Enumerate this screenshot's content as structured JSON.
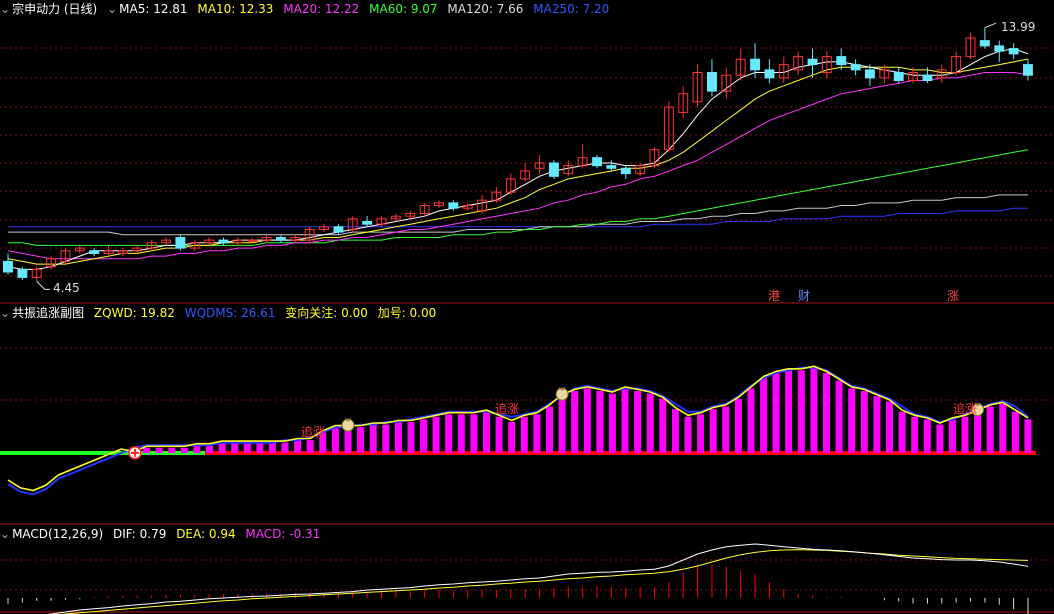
{
  "colors": {
    "bg": "#000000",
    "grid": "#8a1010",
    "up": "#ff3333",
    "down": "#66e8ff",
    "ma5": "#ffffff",
    "ma10": "#ffff33",
    "ma20": "#ff33ff",
    "ma60": "#33ff33",
    "ma120": "#c8c8c8",
    "ma250": "#3333ff",
    "bar": "#ff00ff",
    "red": "#ff0000",
    "green": "#22ff22"
  },
  "header": {
    "title_menu_icon": "dropdown-arrow-icon",
    "name": "宗申动力 (日线)",
    "ma5": "MA5: 12.81",
    "ma10": "MA10: 12.33",
    "ma20": "MA20: 12.22",
    "ma60": "MA60: 9.07",
    "ma120": "MA120: 7.66",
    "ma250": "MA250: 7.20",
    "high_label": "13.99",
    "low_label": "4.45",
    "tags": [
      "港",
      "财",
      "涨"
    ]
  },
  "panel2": {
    "name": "共振追涨副图",
    "zqwd": "ZQWD: 19.82",
    "wqdms": "WQDMS: 26.61",
    "bianxiang": "变向关注: 0.00",
    "jiahao": "加号: 0.00",
    "signal_label": "追涨"
  },
  "panel3": {
    "name": "MACD(12,26,9)",
    "dif": "DIF: 0.79",
    "dea": "DEA: 0.94",
    "macd": "MACD: -0.31"
  },
  "chart_data": [
    {
      "type": "candlestick",
      "title": "宗申动力 (日线)",
      "price_range": [
        4.45,
        13.99
      ],
      "candles": [
        {
          "o": 5.2,
          "c": 4.8,
          "h": 5.5,
          "l": 4.7
        },
        {
          "o": 4.9,
          "c": 4.6,
          "h": 5.0,
          "l": 4.5
        },
        {
          "o": 4.6,
          "c": 4.9,
          "h": 5.0,
          "l": 4.45
        },
        {
          "o": 5.0,
          "c": 5.3,
          "h": 5.4,
          "l": 4.9
        },
        {
          "o": 5.2,
          "c": 5.6,
          "h": 5.7,
          "l": 5.1
        },
        {
          "o": 5.6,
          "c": 5.7,
          "h": 5.8,
          "l": 5.5
        },
        {
          "o": 5.6,
          "c": 5.5,
          "h": 5.7,
          "l": 5.4
        },
        {
          "o": 5.5,
          "c": 5.6,
          "h": 5.8,
          "l": 5.4
        },
        {
          "o": 5.5,
          "c": 5.6,
          "h": 5.7,
          "l": 5.4
        },
        {
          "o": 5.6,
          "c": 5.7,
          "h": 5.8,
          "l": 5.5
        },
        {
          "o": 5.7,
          "c": 5.9,
          "h": 6.0,
          "l": 5.6
        },
        {
          "o": 5.9,
          "c": 6.0,
          "h": 6.1,
          "l": 5.8
        },
        {
          "o": 6.1,
          "c": 5.7,
          "h": 6.2,
          "l": 5.6
        },
        {
          "o": 5.7,
          "c": 5.9,
          "h": 6.0,
          "l": 5.6
        },
        {
          "o": 5.9,
          "c": 6.0,
          "h": 6.1,
          "l": 5.8
        },
        {
          "o": 6.0,
          "c": 5.9,
          "h": 6.1,
          "l": 5.8
        },
        {
          "o": 5.9,
          "c": 6.0,
          "h": 6.1,
          "l": 5.8
        },
        {
          "o": 6.0,
          "c": 6.0,
          "h": 6.1,
          "l": 5.9
        },
        {
          "o": 6.0,
          "c": 6.1,
          "h": 6.2,
          "l": 5.9
        },
        {
          "o": 6.1,
          "c": 6.0,
          "h": 6.2,
          "l": 5.9
        },
        {
          "o": 6.0,
          "c": 6.1,
          "h": 6.2,
          "l": 5.9
        },
        {
          "o": 6.0,
          "c": 6.4,
          "h": 6.5,
          "l": 5.9
        },
        {
          "o": 6.4,
          "c": 6.5,
          "h": 6.6,
          "l": 6.3
        },
        {
          "o": 6.5,
          "c": 6.3,
          "h": 6.6,
          "l": 6.2
        },
        {
          "o": 6.4,
          "c": 6.8,
          "h": 6.9,
          "l": 6.3
        },
        {
          "o": 6.7,
          "c": 6.6,
          "h": 6.9,
          "l": 6.5
        },
        {
          "o": 6.6,
          "c": 6.8,
          "h": 6.9,
          "l": 6.5
        },
        {
          "o": 6.8,
          "c": 6.9,
          "h": 7.0,
          "l": 6.7
        },
        {
          "o": 6.9,
          "c": 7.0,
          "h": 7.1,
          "l": 6.8
        },
        {
          "o": 7.0,
          "c": 7.3,
          "h": 7.4,
          "l": 6.9
        },
        {
          "o": 7.3,
          "c": 7.4,
          "h": 7.5,
          "l": 7.2
        },
        {
          "o": 7.4,
          "c": 7.2,
          "h": 7.5,
          "l": 7.1
        },
        {
          "o": 7.2,
          "c": 7.3,
          "h": 7.4,
          "l": 7.1
        },
        {
          "o": 7.1,
          "c": 7.5,
          "h": 7.7,
          "l": 7.0
        },
        {
          "o": 7.5,
          "c": 7.8,
          "h": 8.0,
          "l": 7.4
        },
        {
          "o": 7.8,
          "c": 8.3,
          "h": 8.5,
          "l": 7.7
        },
        {
          "o": 8.3,
          "c": 8.6,
          "h": 8.9,
          "l": 8.2
        },
        {
          "o": 8.7,
          "c": 8.9,
          "h": 9.2,
          "l": 8.5
        },
        {
          "o": 8.9,
          "c": 8.4,
          "h": 9.0,
          "l": 8.3
        },
        {
          "o": 8.5,
          "c": 8.8,
          "h": 9.0,
          "l": 8.4
        },
        {
          "o": 8.8,
          "c": 9.1,
          "h": 9.6,
          "l": 8.7
        },
        {
          "o": 9.1,
          "c": 8.8,
          "h": 9.2,
          "l": 8.7
        },
        {
          "o": 8.8,
          "c": 8.7,
          "h": 9.0,
          "l": 8.6
        },
        {
          "o": 8.7,
          "c": 8.5,
          "h": 8.8,
          "l": 8.3
        },
        {
          "o": 8.5,
          "c": 8.8,
          "h": 8.9,
          "l": 8.4
        },
        {
          "o": 8.8,
          "c": 9.4,
          "h": 9.5,
          "l": 8.7
        },
        {
          "o": 9.4,
          "c": 11.0,
          "h": 11.2,
          "l": 9.3
        },
        {
          "o": 10.8,
          "c": 11.5,
          "h": 11.8,
          "l": 10.6
        },
        {
          "o": 11.2,
          "c": 12.3,
          "h": 12.6,
          "l": 11.0
        },
        {
          "o": 12.3,
          "c": 11.6,
          "h": 12.8,
          "l": 11.4
        },
        {
          "o": 11.6,
          "c": 12.2,
          "h": 12.5,
          "l": 11.3
        },
        {
          "o": 12.2,
          "c": 12.8,
          "h": 13.2,
          "l": 12.0
        },
        {
          "o": 12.8,
          "c": 12.4,
          "h": 13.4,
          "l": 12.1
        },
        {
          "o": 12.4,
          "c": 12.1,
          "h": 12.8,
          "l": 11.9
        },
        {
          "o": 12.1,
          "c": 12.6,
          "h": 12.9,
          "l": 11.9
        },
        {
          "o": 12.4,
          "c": 12.9,
          "h": 13.1,
          "l": 12.2
        },
        {
          "o": 12.8,
          "c": 12.6,
          "h": 13.2,
          "l": 12.1
        },
        {
          "o": 12.3,
          "c": 12.9,
          "h": 13.1,
          "l": 12.1
        },
        {
          "o": 12.9,
          "c": 12.6,
          "h": 13.2,
          "l": 12.4
        },
        {
          "o": 12.6,
          "c": 12.4,
          "h": 12.8,
          "l": 12.2
        },
        {
          "o": 12.4,
          "c": 12.1,
          "h": 12.6,
          "l": 11.8
        },
        {
          "o": 12.1,
          "c": 12.4,
          "h": 12.6,
          "l": 11.9
        },
        {
          "o": 12.3,
          "c": 12.0,
          "h": 12.5,
          "l": 11.9
        },
        {
          "o": 12.0,
          "c": 12.3,
          "h": 12.5,
          "l": 11.9
        },
        {
          "o": 12.2,
          "c": 12.0,
          "h": 12.5,
          "l": 11.9
        },
        {
          "o": 12.1,
          "c": 12.4,
          "h": 12.6,
          "l": 11.9
        },
        {
          "o": 12.3,
          "c": 12.9,
          "h": 13.1,
          "l": 12.2
        },
        {
          "o": 12.9,
          "c": 13.6,
          "h": 13.8,
          "l": 12.8
        },
        {
          "o": 13.5,
          "c": 13.3,
          "h": 13.99,
          "l": 13.2
        },
        {
          "o": 13.3,
          "c": 13.1,
          "h": 13.5,
          "l": 12.7
        },
        {
          "o": 13.2,
          "c": 13.0,
          "h": 13.4,
          "l": 12.8
        },
        {
          "o": 12.6,
          "c": 12.2,
          "h": 12.8,
          "l": 12.0
        }
      ],
      "ma5": [
        5.0,
        4.9,
        4.9,
        5.0,
        5.2,
        5.4,
        5.6,
        5.6,
        5.6,
        5.6,
        5.7,
        5.8,
        5.8,
        5.9,
        5.9,
        5.9,
        6.0,
        6.0,
        6.0,
        6.0,
        6.0,
        6.1,
        6.2,
        6.3,
        6.4,
        6.5,
        6.6,
        6.7,
        6.8,
        6.9,
        7.1,
        7.2,
        7.3,
        7.4,
        7.5,
        7.8,
        8.1,
        8.4,
        8.6,
        8.7,
        8.8,
        8.9,
        8.9,
        8.8,
        8.8,
        8.9,
        9.4,
        10.0,
        10.7,
        11.3,
        11.7,
        12.1,
        12.3,
        12.3,
        12.3,
        12.5,
        12.6,
        12.7,
        12.7,
        12.6,
        12.5,
        12.4,
        12.3,
        12.2,
        12.2,
        12.2,
        12.3,
        12.6,
        12.9,
        13.1,
        13.2,
        13.0
      ],
      "ma10": [
        5.3,
        5.2,
        5.1,
        5.1,
        5.1,
        5.2,
        5.3,
        5.4,
        5.5,
        5.5,
        5.6,
        5.7,
        5.7,
        5.8,
        5.8,
        5.9,
        5.9,
        5.9,
        6.0,
        6.0,
        6.0,
        6.0,
        6.1,
        6.1,
        6.2,
        6.3,
        6.4,
        6.5,
        6.6,
        6.7,
        6.8,
        6.9,
        7.0,
        7.1,
        7.2,
        7.4,
        7.6,
        7.9,
        8.1,
        8.3,
        8.4,
        8.5,
        8.6,
        8.7,
        8.7,
        8.8,
        9.0,
        9.3,
        9.7,
        10.1,
        10.5,
        10.9,
        11.3,
        11.6,
        11.8,
        12.0,
        12.2,
        12.4,
        12.5,
        12.5,
        12.5,
        12.5,
        12.5,
        12.4,
        12.4,
        12.3,
        12.3,
        12.4,
        12.5,
        12.6,
        12.7,
        12.81
      ],
      "ma20": [
        5.6,
        5.5,
        5.4,
        5.3,
        5.3,
        5.3,
        5.3,
        5.3,
        5.3,
        5.3,
        5.4,
        5.4,
        5.5,
        5.5,
        5.6,
        5.6,
        5.7,
        5.7,
        5.8,
        5.8,
        5.9,
        5.9,
        6.0,
        6.0,
        6.1,
        6.1,
        6.2,
        6.3,
        6.4,
        6.4,
        6.5,
        6.6,
        6.7,
        6.8,
        6.9,
        7.0,
        7.1,
        7.2,
        7.4,
        7.5,
        7.7,
        7.8,
        8.0,
        8.1,
        8.3,
        8.4,
        8.6,
        8.8,
        9.0,
        9.3,
        9.6,
        9.9,
        10.2,
        10.5,
        10.7,
        10.9,
        11.1,
        11.3,
        11.5,
        11.6,
        11.7,
        11.8,
        11.9,
        12.0,
        12.0,
        12.1,
        12.1,
        12.2,
        12.3,
        12.3,
        12.3,
        12.22
      ],
      "ma60": [
        5.9,
        5.9,
        5.8,
        5.8,
        5.8,
        5.8,
        5.8,
        5.8,
        5.8,
        5.8,
        5.8,
        5.8,
        5.8,
        5.8,
        5.8,
        5.8,
        5.8,
        5.8,
        5.9,
        5.9,
        5.9,
        5.9,
        5.9,
        6.0,
        6.0,
        6.0,
        6.0,
        6.1,
        6.1,
        6.1,
        6.1,
        6.2,
        6.2,
        6.2,
        6.3,
        6.3,
        6.4,
        6.4,
        6.5,
        6.5,
        6.6,
        6.6,
        6.7,
        6.7,
        6.8,
        6.8,
        6.9,
        7.0,
        7.1,
        7.2,
        7.3,
        7.4,
        7.5,
        7.6,
        7.7,
        7.8,
        7.9,
        8.0,
        8.1,
        8.2,
        8.3,
        8.4,
        8.5,
        8.6,
        8.7,
        8.8,
        8.9,
        9.0,
        9.1,
        9.2,
        9.3,
        9.4
      ],
      "ma120": [
        6.3,
        6.3,
        6.3,
        6.3,
        6.3,
        6.3,
        6.3,
        6.3,
        6.2,
        6.2,
        6.2,
        6.2,
        6.2,
        6.2,
        6.2,
        6.2,
        6.2,
        6.2,
        6.2,
        6.2,
        6.2,
        6.2,
        6.2,
        6.2,
        6.3,
        6.3,
        6.3,
        6.3,
        6.3,
        6.3,
        6.3,
        6.3,
        6.4,
        6.4,
        6.4,
        6.4,
        6.4,
        6.5,
        6.5,
        6.5,
        6.5,
        6.6,
        6.6,
        6.6,
        6.7,
        6.7,
        6.7,
        6.8,
        6.8,
        6.9,
        6.9,
        7.0,
        7.0,
        7.1,
        7.1,
        7.2,
        7.2,
        7.2,
        7.3,
        7.3,
        7.4,
        7.4,
        7.4,
        7.5,
        7.5,
        7.5,
        7.6,
        7.6,
        7.6,
        7.7,
        7.7,
        7.7
      ],
      "ma250": [
        6.5,
        6.5,
        6.5,
        6.5,
        6.5,
        6.5,
        6.5,
        6.5,
        6.5,
        6.5,
        6.5,
        6.5,
        6.5,
        6.5,
        6.5,
        6.5,
        6.5,
        6.5,
        6.5,
        6.5,
        6.5,
        6.5,
        6.5,
        6.5,
        6.5,
        6.5,
        6.5,
        6.5,
        6.5,
        6.5,
        6.5,
        6.5,
        6.5,
        6.5,
        6.5,
        6.5,
        6.5,
        6.5,
        6.5,
        6.5,
        6.5,
        6.5,
        6.5,
        6.5,
        6.5,
        6.6,
        6.6,
        6.6,
        6.6,
        6.6,
        6.7,
        6.7,
        6.7,
        6.7,
        6.8,
        6.8,
        6.8,
        6.8,
        6.9,
        6.9,
        6.9,
        6.9,
        7.0,
        7.0,
        7.0,
        7.0,
        7.1,
        7.1,
        7.1,
        7.1,
        7.2,
        7.2
      ]
    },
    {
      "type": "bar",
      "title": "共振追涨副图",
      "y_range": [
        -20,
        40
      ],
      "zqwd_bars": [
        0,
        0,
        0,
        0,
        0,
        0,
        0,
        0,
        0,
        0,
        0,
        2,
        2,
        2,
        2,
        3,
        3,
        4,
        4,
        4,
        4,
        4,
        4,
        5,
        5,
        8,
        10,
        10,
        10,
        11,
        11,
        12,
        12,
        13,
        14,
        15,
        15,
        15,
        16,
        14,
        12,
        14,
        15,
        18,
        22,
        24,
        25,
        24,
        23,
        25,
        24,
        23,
        21,
        17,
        14,
        15,
        17,
        18,
        21,
        25,
        29,
        31,
        32,
        32,
        33,
        31,
        28,
        25,
        24,
        22,
        20,
        16,
        14,
        13,
        11,
        13,
        14,
        16,
        18,
        19,
        16,
        13
      ],
      "wqdms": [
        -12,
        -15,
        -16,
        -14,
        -10,
        -8,
        -6,
        -4,
        -2,
        0,
        2,
        3,
        3,
        3,
        3,
        3,
        3,
        4,
        4,
        4,
        4,
        4,
        5,
        5,
        6,
        8,
        10,
        10,
        11,
        11,
        12,
        12,
        13,
        14,
        15,
        16,
        16,
        16,
        16,
        15,
        14,
        15,
        16,
        19,
        22,
        25,
        26,
        25,
        24,
        25,
        25,
        24,
        22,
        19,
        16,
        16,
        18,
        19,
        22,
        26,
        29,
        31,
        32,
        33,
        33,
        32,
        29,
        26,
        25,
        23,
        21,
        18,
        15,
        14,
        12,
        13,
        15,
        17,
        19,
        20,
        18,
        14
      ],
      "signals": [
        27,
        44,
        77
      ]
    },
    {
      "type": "line",
      "title": "MACD(12,26,9)",
      "y_range": [
        -0.6,
        1.6
      ],
      "dif": [
        -0.5,
        -0.5,
        -0.45,
        -0.4,
        -0.35,
        -0.3,
        -0.27,
        -0.24,
        -0.2,
        -0.17,
        -0.14,
        -0.1,
        -0.08,
        -0.05,
        -0.02,
        0.0,
        0.02,
        0.04,
        0.05,
        0.07,
        0.09,
        0.1,
        0.12,
        0.14,
        0.16,
        0.2,
        0.22,
        0.24,
        0.26,
        0.3,
        0.33,
        0.35,
        0.38,
        0.4,
        0.42,
        0.45,
        0.48,
        0.5,
        0.55,
        0.6,
        0.62,
        0.64,
        0.65,
        0.67,
        0.7,
        0.72,
        0.8,
        0.95,
        1.1,
        1.2,
        1.28,
        1.32,
        1.35,
        1.32,
        1.28,
        1.25,
        1.22,
        1.2,
        1.18,
        1.15,
        1.12,
        1.08,
        1.04,
        1.0,
        0.98,
        0.96,
        0.95,
        0.95,
        0.93,
        0.9,
        0.85,
        0.79
      ],
      "dea": [
        -0.45,
        -0.46,
        -0.45,
        -0.43,
        -0.4,
        -0.37,
        -0.34,
        -0.31,
        -0.28,
        -0.25,
        -0.22,
        -0.19,
        -0.16,
        -0.13,
        -0.1,
        -0.07,
        -0.05,
        -0.02,
        0.0,
        0.02,
        0.04,
        0.06,
        0.08,
        0.1,
        0.12,
        0.14,
        0.16,
        0.18,
        0.2,
        0.22,
        0.25,
        0.27,
        0.3,
        0.32,
        0.35,
        0.37,
        0.4,
        0.42,
        0.45,
        0.48,
        0.5,
        0.53,
        0.55,
        0.58,
        0.6,
        0.62,
        0.66,
        0.72,
        0.8,
        0.9,
        1.0,
        1.08,
        1.14,
        1.18,
        1.2,
        1.21,
        1.2,
        1.19,
        1.17,
        1.15,
        1.12,
        1.1,
        1.07,
        1.05,
        1.03,
        1.01,
        0.99,
        0.98,
        0.97,
        0.96,
        0.95,
        0.94
      ],
      "macd": [
        -0.1,
        -0.08,
        -0.05,
        -0.05,
        -0.03,
        -0.02,
        0.02,
        0.03,
        0.04,
        0.04,
        0.05,
        0.05,
        0.06,
        0.06,
        0.06,
        0.07,
        0.07,
        0.08,
        0.08,
        0.08,
        0.09,
        0.09,
        0.09,
        0.1,
        0.1,
        0.12,
        0.12,
        0.12,
        0.12,
        0.14,
        0.14,
        0.14,
        0.14,
        0.14,
        0.14,
        0.15,
        0.16,
        0.16,
        0.18,
        0.2,
        0.2,
        0.22,
        0.2,
        0.18,
        0.2,
        0.2,
        0.28,
        0.46,
        0.6,
        0.6,
        0.56,
        0.48,
        0.42,
        0.28,
        0.16,
        0.08,
        0.04,
        0.02,
        0.02,
        0.0,
        0.0,
        -0.04,
        -0.06,
        -0.1,
        -0.1,
        -0.1,
        -0.08,
        -0.06,
        -0.08,
        -0.12,
        -0.2,
        -0.31
      ]
    }
  ]
}
